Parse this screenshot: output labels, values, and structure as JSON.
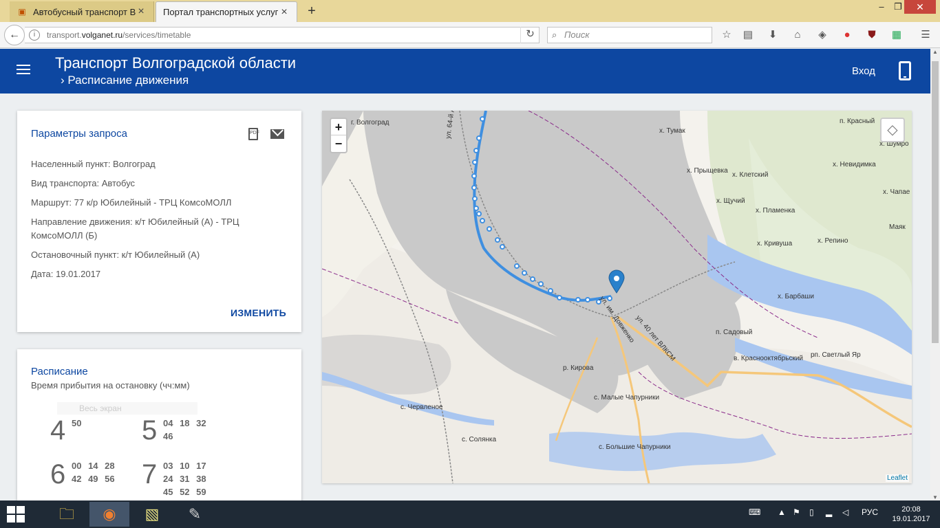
{
  "browser": {
    "tabs": [
      {
        "label": "Автобусный транспорт В...",
        "active": false,
        "icon": "speech-bubble-icon"
      },
      {
        "label": "Портал транспортных услуг ...",
        "active": true,
        "icon": ""
      }
    ],
    "url_prefix": "transport.",
    "url_host": "volganet.ru",
    "url_path": "/services/timetable",
    "search_placeholder": "Поиск"
  },
  "header": {
    "title": "Транспорт Волгоградской области",
    "subtitle": "Расписание движения",
    "login_label": "Вход",
    "color": "#0d47a1"
  },
  "params": {
    "title": "Параметры запроса",
    "locality": "Населенный пункт: Волгоград",
    "transport": "Вид транспорта: Автобус",
    "route": "Маршрут: 77 к/р Юбилейный - ТРЦ КомсоМОЛЛ",
    "direction": "Направление движения: к/т Юбилейный (А) - ТРЦ КомсоМОЛЛ (Б)",
    "stop": "Остановочный пункт: к/т Юбилейный (А)",
    "date": "Дата: 19.01.2017",
    "change_label": "ИЗМЕНИТЬ"
  },
  "schedule": {
    "title": "Расписание",
    "subtitle": "Время прибытия на остановку (чч:мм)",
    "fullscreen_label": "Весь экран",
    "hours": [
      {
        "hour": "4",
        "minutes": [
          "50"
        ]
      },
      {
        "hour": "5",
        "minutes": [
          "04 18 32",
          "46"
        ]
      },
      {
        "hour": "6",
        "minutes": [
          "00 14 28",
          "42 49 56"
        ]
      },
      {
        "hour": "7",
        "minutes": [
          "03 10 17",
          "24 31 38",
          "45 52 59"
        ]
      }
    ]
  },
  "map": {
    "zoom_in": "+",
    "zoom_out": "−",
    "attribution": "Leaflet",
    "labels": [
      {
        "text": "г. Волгоград"
      },
      {
        "text": "х. Тумак"
      },
      {
        "text": "п. Красный"
      },
      {
        "text": "х. Шумро"
      },
      {
        "text": "х. Прыщевка"
      },
      {
        "text": "х. Клетский"
      },
      {
        "text": "х. Невидимка"
      },
      {
        "text": "х. Чапае"
      },
      {
        "text": "х. Щучий"
      },
      {
        "text": "х. Пламенка"
      },
      {
        "text": "Маяк"
      },
      {
        "text": "х. Кривуша"
      },
      {
        "text": "х. Репино"
      },
      {
        "text": "х. Барбаши"
      },
      {
        "text": "п. Садовый"
      },
      {
        "text": "рп. Светлый Яр"
      },
      {
        "text": "в. Краснооктябрьский"
      },
      {
        "text": "р. Кирова"
      },
      {
        "text": "с. Малые Чапурники"
      },
      {
        "text": "с. Червленое"
      },
      {
        "text": "с. Солянка"
      },
      {
        "text": "с. Большие Чапурники"
      },
      {
        "text": "ул. 64-й Армии"
      },
      {
        "text": "ул. им. Довженко"
      },
      {
        "text": "ул. 40 лет ВЛКСМ"
      }
    ]
  },
  "taskbar": {
    "lang": "РУС",
    "time": "20:08",
    "date": "19.01.2017"
  }
}
